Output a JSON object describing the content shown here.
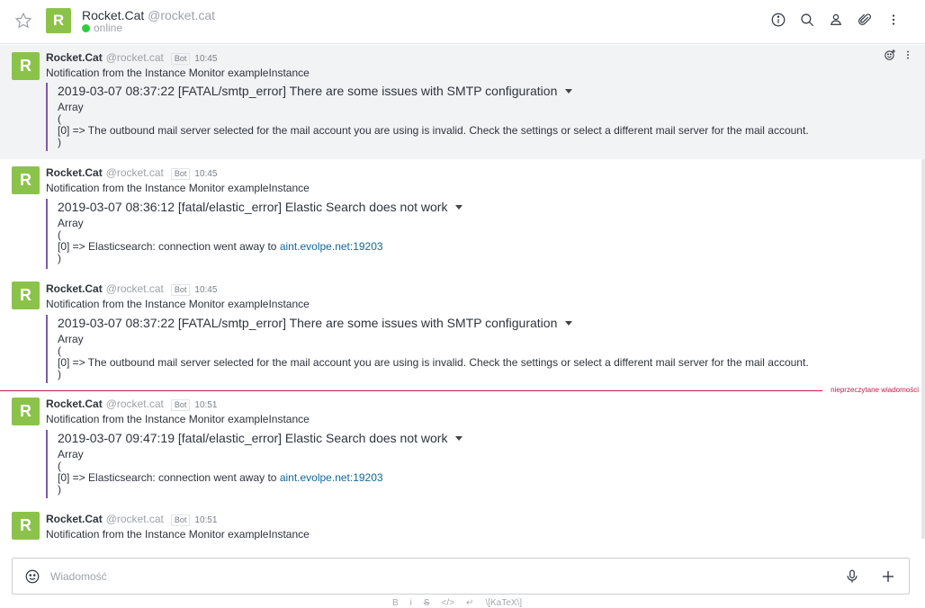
{
  "header": {
    "avatar_letter": "R",
    "name": "Rocket.Cat",
    "username": "@rocket.cat",
    "status": "online"
  },
  "messages": [
    {
      "avatar_letter": "R",
      "name": "Rocket.Cat",
      "username": "@rocket.cat",
      "badge": "Bot",
      "time": "10:45",
      "text": "Notification from the Instance Monitor exampleInstance",
      "attachment_title": "2019-03-07 08:37:22 [FATAL/smtp_error] There are some issues with SMTP configuration",
      "lines": [
        "Array",
        "(",
        "[0] => The outbound mail server selected for the mail account you are using is invalid. Check the settings or select a different mail server for the mail account.",
        ")"
      ],
      "link": ""
    },
    {
      "avatar_letter": "R",
      "name": "Rocket.Cat",
      "username": "@rocket.cat",
      "badge": "Bot",
      "time": "10:45",
      "text": "Notification from the Instance Monitor exampleInstance",
      "attachment_title": "2019-03-07 08:36:12 [fatal/elastic_error] Elastic Search does not work",
      "lines": [
        "Array",
        "(",
        "[0] => Elasticsearch: connection went away to ",
        ")"
      ],
      "link": "aint.evolpe.net:19203"
    },
    {
      "avatar_letter": "R",
      "name": "Rocket.Cat",
      "username": "@rocket.cat",
      "badge": "Bot",
      "time": "10:45",
      "text": "Notification from the Instance Monitor exampleInstance",
      "attachment_title": "2019-03-07 08:37:22 [FATAL/smtp_error] There are some issues with SMTP configuration",
      "lines": [
        "Array",
        "(",
        "[0] => The outbound mail server selected for the mail account you are using is invalid. Check the settings or select a different mail server for the mail account.",
        ")"
      ],
      "link": ""
    },
    {
      "avatar_letter": "R",
      "name": "Rocket.Cat",
      "username": "@rocket.cat",
      "badge": "Bot",
      "time": "10:51",
      "text": "Notification from the Instance Monitor exampleInstance",
      "attachment_title": "2019-03-07 09:47:19 [fatal/elastic_error] Elastic Search does not work",
      "lines": [
        "Array",
        "(",
        "[0] => Elasticsearch: connection went away to ",
        ")"
      ],
      "link": "aint.evolpe.net:19203"
    },
    {
      "avatar_letter": "R",
      "name": "Rocket.Cat",
      "username": "@rocket.cat",
      "badge": "Bot",
      "time": "10:51",
      "text": "Notification from the Instance Monitor exampleInstance"
    }
  ],
  "unread_label": "nieprzeczytane wiadomości",
  "composer": {
    "placeholder": "Wiadomość",
    "value": ""
  },
  "formatting": {
    "bold": "B",
    "italic": "i",
    "strike": "S",
    "code": "</>",
    "newline": "↵",
    "katex": "\\[KaTeX\\]"
  },
  "colors": {
    "avatar": "#8bc34a",
    "attachment_border": "#7d5ba6",
    "unread": "#c61c4b",
    "link": "#13679a"
  }
}
